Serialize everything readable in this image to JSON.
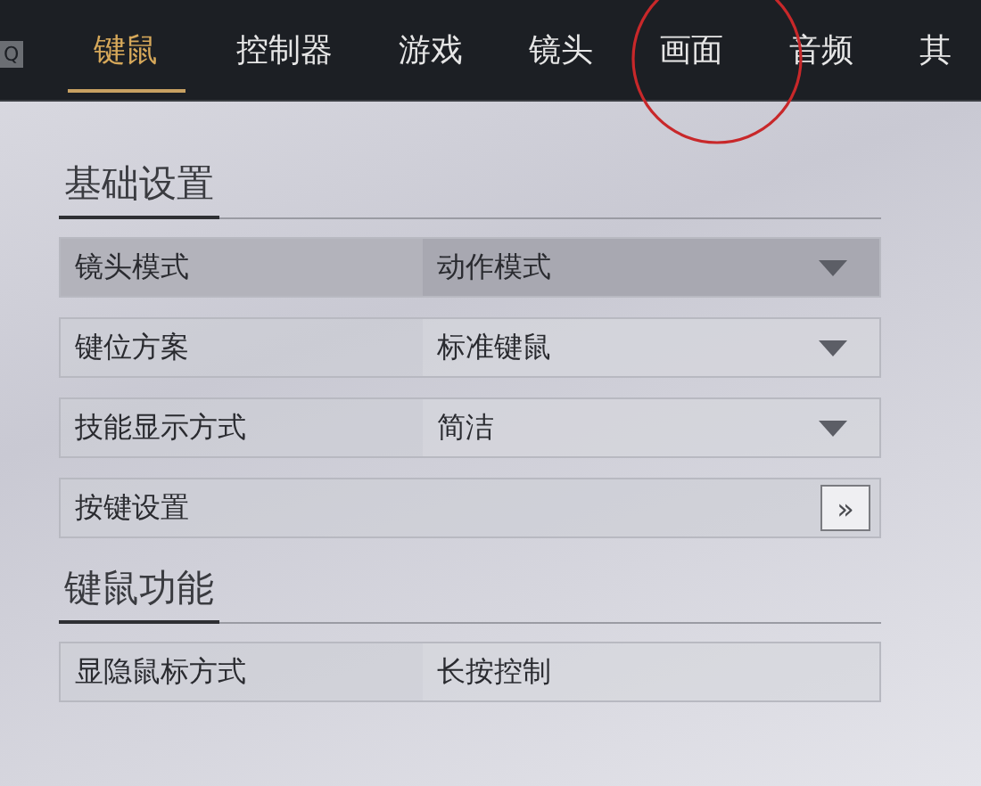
{
  "top_bar": {
    "search_key": "Q"
  },
  "tabs": [
    {
      "label": "键鼠",
      "selected": true
    },
    {
      "label": "控制器",
      "selected": false
    },
    {
      "label": "游戏",
      "selected": false
    },
    {
      "label": "镜头",
      "selected": false
    },
    {
      "label": "画面",
      "selected": false
    },
    {
      "label": "音频",
      "selected": false
    },
    {
      "label": "其",
      "selected": false
    }
  ],
  "sections": [
    {
      "title": "基础设置",
      "rows": [
        {
          "kind": "dropdown",
          "label": "镜头模式",
          "value": "动作模式",
          "selected": true
        },
        {
          "kind": "dropdown",
          "label": "键位方案",
          "value": "标准键鼠",
          "selected": false
        },
        {
          "kind": "dropdown",
          "label": "技能显示方式",
          "value": "简洁",
          "selected": false
        },
        {
          "kind": "link",
          "label": "按键设置",
          "button": "»",
          "selected": false
        }
      ]
    },
    {
      "title": "键鼠功能",
      "rows": [
        {
          "kind": "value",
          "label": "显隐鼠标方式",
          "value": "长按控制",
          "selected": false
        }
      ]
    }
  ]
}
